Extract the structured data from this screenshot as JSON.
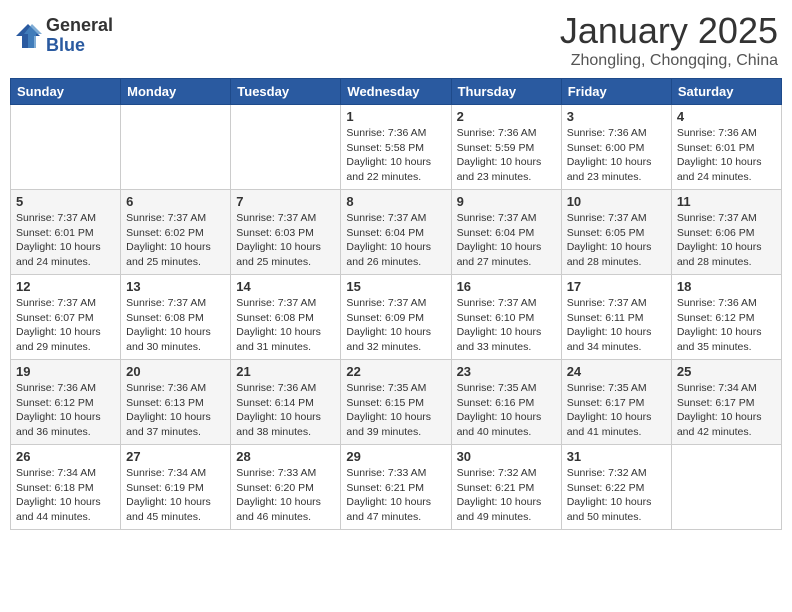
{
  "header": {
    "logo_general": "General",
    "logo_blue": "Blue",
    "month_year": "January 2025",
    "location": "Zhongling, Chongqing, China"
  },
  "days_of_week": [
    "Sunday",
    "Monday",
    "Tuesday",
    "Wednesday",
    "Thursday",
    "Friday",
    "Saturday"
  ],
  "weeks": [
    [
      {
        "day": "",
        "info": ""
      },
      {
        "day": "",
        "info": ""
      },
      {
        "day": "",
        "info": ""
      },
      {
        "day": "1",
        "info": "Sunrise: 7:36 AM\nSunset: 5:58 PM\nDaylight: 10 hours\nand 22 minutes."
      },
      {
        "day": "2",
        "info": "Sunrise: 7:36 AM\nSunset: 5:59 PM\nDaylight: 10 hours\nand 23 minutes."
      },
      {
        "day": "3",
        "info": "Sunrise: 7:36 AM\nSunset: 6:00 PM\nDaylight: 10 hours\nand 23 minutes."
      },
      {
        "day": "4",
        "info": "Sunrise: 7:36 AM\nSunset: 6:01 PM\nDaylight: 10 hours\nand 24 minutes."
      }
    ],
    [
      {
        "day": "5",
        "info": "Sunrise: 7:37 AM\nSunset: 6:01 PM\nDaylight: 10 hours\nand 24 minutes."
      },
      {
        "day": "6",
        "info": "Sunrise: 7:37 AM\nSunset: 6:02 PM\nDaylight: 10 hours\nand 25 minutes."
      },
      {
        "day": "7",
        "info": "Sunrise: 7:37 AM\nSunset: 6:03 PM\nDaylight: 10 hours\nand 25 minutes."
      },
      {
        "day": "8",
        "info": "Sunrise: 7:37 AM\nSunset: 6:04 PM\nDaylight: 10 hours\nand 26 minutes."
      },
      {
        "day": "9",
        "info": "Sunrise: 7:37 AM\nSunset: 6:04 PM\nDaylight: 10 hours\nand 27 minutes."
      },
      {
        "day": "10",
        "info": "Sunrise: 7:37 AM\nSunset: 6:05 PM\nDaylight: 10 hours\nand 28 minutes."
      },
      {
        "day": "11",
        "info": "Sunrise: 7:37 AM\nSunset: 6:06 PM\nDaylight: 10 hours\nand 28 minutes."
      }
    ],
    [
      {
        "day": "12",
        "info": "Sunrise: 7:37 AM\nSunset: 6:07 PM\nDaylight: 10 hours\nand 29 minutes."
      },
      {
        "day": "13",
        "info": "Sunrise: 7:37 AM\nSunset: 6:08 PM\nDaylight: 10 hours\nand 30 minutes."
      },
      {
        "day": "14",
        "info": "Sunrise: 7:37 AM\nSunset: 6:08 PM\nDaylight: 10 hours\nand 31 minutes."
      },
      {
        "day": "15",
        "info": "Sunrise: 7:37 AM\nSunset: 6:09 PM\nDaylight: 10 hours\nand 32 minutes."
      },
      {
        "day": "16",
        "info": "Sunrise: 7:37 AM\nSunset: 6:10 PM\nDaylight: 10 hours\nand 33 minutes."
      },
      {
        "day": "17",
        "info": "Sunrise: 7:37 AM\nSunset: 6:11 PM\nDaylight: 10 hours\nand 34 minutes."
      },
      {
        "day": "18",
        "info": "Sunrise: 7:36 AM\nSunset: 6:12 PM\nDaylight: 10 hours\nand 35 minutes."
      }
    ],
    [
      {
        "day": "19",
        "info": "Sunrise: 7:36 AM\nSunset: 6:12 PM\nDaylight: 10 hours\nand 36 minutes."
      },
      {
        "day": "20",
        "info": "Sunrise: 7:36 AM\nSunset: 6:13 PM\nDaylight: 10 hours\nand 37 minutes."
      },
      {
        "day": "21",
        "info": "Sunrise: 7:36 AM\nSunset: 6:14 PM\nDaylight: 10 hours\nand 38 minutes."
      },
      {
        "day": "22",
        "info": "Sunrise: 7:35 AM\nSunset: 6:15 PM\nDaylight: 10 hours\nand 39 minutes."
      },
      {
        "day": "23",
        "info": "Sunrise: 7:35 AM\nSunset: 6:16 PM\nDaylight: 10 hours\nand 40 minutes."
      },
      {
        "day": "24",
        "info": "Sunrise: 7:35 AM\nSunset: 6:17 PM\nDaylight: 10 hours\nand 41 minutes."
      },
      {
        "day": "25",
        "info": "Sunrise: 7:34 AM\nSunset: 6:17 PM\nDaylight: 10 hours\nand 42 minutes."
      }
    ],
    [
      {
        "day": "26",
        "info": "Sunrise: 7:34 AM\nSunset: 6:18 PM\nDaylight: 10 hours\nand 44 minutes."
      },
      {
        "day": "27",
        "info": "Sunrise: 7:34 AM\nSunset: 6:19 PM\nDaylight: 10 hours\nand 45 minutes."
      },
      {
        "day": "28",
        "info": "Sunrise: 7:33 AM\nSunset: 6:20 PM\nDaylight: 10 hours\nand 46 minutes."
      },
      {
        "day": "29",
        "info": "Sunrise: 7:33 AM\nSunset: 6:21 PM\nDaylight: 10 hours\nand 47 minutes."
      },
      {
        "day": "30",
        "info": "Sunrise: 7:32 AM\nSunset: 6:21 PM\nDaylight: 10 hours\nand 49 minutes."
      },
      {
        "day": "31",
        "info": "Sunrise: 7:32 AM\nSunset: 6:22 PM\nDaylight: 10 hours\nand 50 minutes."
      },
      {
        "day": "",
        "info": ""
      }
    ]
  ]
}
